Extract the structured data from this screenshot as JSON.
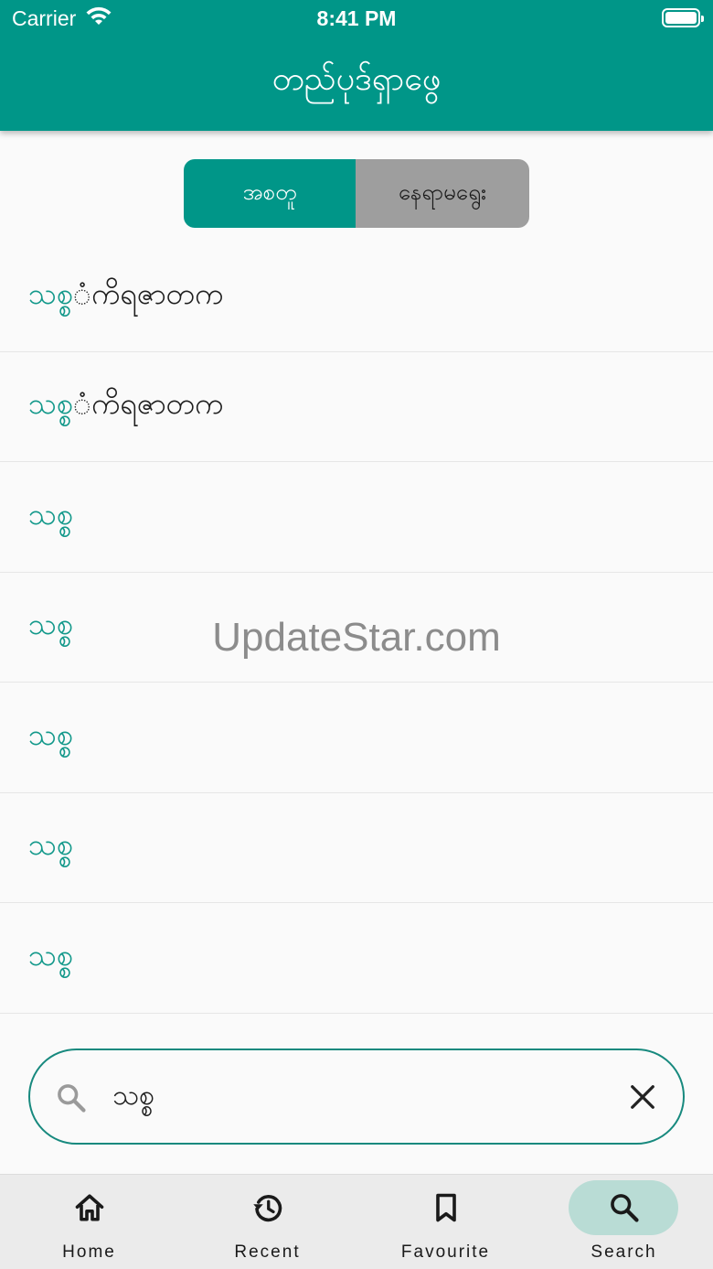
{
  "status_bar": {
    "carrier": "Carrier",
    "time": "8:41 PM"
  },
  "app_bar": {
    "title": "တည်ပုဒ်ရှာဖွေ"
  },
  "segment": {
    "options": [
      "အစတူ",
      "နေရာမရွေး"
    ],
    "selected_index": 0
  },
  "results": [
    {
      "match": "သစ္စ",
      "rest": "ံကိရဇာတက"
    },
    {
      "match": "သစ္စ",
      "rest": "ံကိရဇာတက"
    },
    {
      "match": "သစ္စ",
      "rest": ""
    },
    {
      "match": "သစ္စ",
      "rest": ""
    },
    {
      "match": "သစ္စ",
      "rest": ""
    },
    {
      "match": "သစ္စ",
      "rest": ""
    },
    {
      "match": "သစ္စ",
      "rest": ""
    }
  ],
  "watermark": "UpdateStar.com",
  "search": {
    "value": "သစ္စ"
  },
  "bottom_nav": {
    "items": [
      {
        "label": "Home",
        "icon": "home-icon"
      },
      {
        "label": "Recent",
        "icon": "history-icon"
      },
      {
        "label": "Favourite",
        "icon": "bookmark-icon"
      },
      {
        "label": "Search",
        "icon": "search-icon"
      }
    ],
    "active_index": 3
  },
  "colors": {
    "primary": "#009688",
    "highlight_text": "#12988a",
    "segment_inactive": "#9e9e9e",
    "nav_active_pill": "#b9dcd5"
  }
}
